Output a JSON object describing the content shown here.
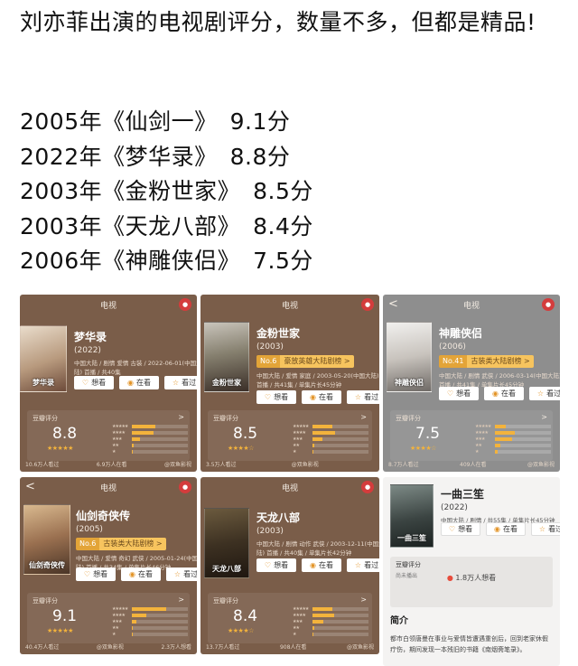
{
  "post": {
    "title": "刘亦菲出演的电视剧评分，数量不多，但都是精品!",
    "ratings": [
      {
        "year": "2005年",
        "title": "《仙剑一》",
        "score": "9.1分"
      },
      {
        "year": "2022年",
        "title": "《梦华录》",
        "score": "8.8分"
      },
      {
        "year": "2003年",
        "title": "《金粉世家》",
        "score": "8.5分"
      },
      {
        "year": "2003年",
        "title": "《天龙八部》",
        "score": "8.4分"
      },
      {
        "year": "2006年",
        "title": "《神雕侠侣》",
        "score": "7.5分"
      }
    ]
  },
  "common": {
    "nav_title": "电视",
    "back": "<",
    "want": "想看",
    "watching": "在看",
    "watched": "看过",
    "score_label": "豆瓣评分",
    "arrow": ">"
  },
  "cards": {
    "menghua": {
      "name": "梦华录",
      "year": "(2022)",
      "meta1": "中国大陆 / 剧情 爱情 古装 / 2022-06-01(中国大",
      "meta2": "陆) 首播 / 共40集",
      "score": "8.8",
      "dist": [
        0.42,
        0.38,
        0.14,
        0.04,
        0.02
      ],
      "footer_left": "10.6万人看过",
      "footer_mid": "6.9万人在看",
      "footer_right": "@双鱼影视",
      "poster_title": "梦华录"
    },
    "jinfen": {
      "name": "金粉世家",
      "year": "(2003)",
      "rank_no": "No.6",
      "rank_label": "豪放英雄大陆剧榜 >",
      "meta1": "中国大陆 / 爱情 家庭 / 2003-05-20(中国大陆)",
      "meta2": "首播 / 共41集 / 单集片长45分钟",
      "score": "8.5",
      "dist": [
        0.36,
        0.4,
        0.18,
        0.04,
        0.02
      ],
      "footer_left": "3.5万人看过",
      "footer_mid": "@双鱼影视",
      "footer_right": "",
      "poster_title": "金粉世家"
    },
    "shendiao": {
      "name": "神雕侠侣",
      "year": "(2006)",
      "rank_no": "No.41",
      "rank_label": "古装类大陆剧榜 >",
      "meta1": "中国大陆 / 剧情 武侠 / 2006-03-14(中国大陆)",
      "meta2": "首播 / 共41集 / 单集片长45分钟",
      "score": "7.5",
      "dist": [
        0.2,
        0.35,
        0.3,
        0.1,
        0.05
      ],
      "footer_left": "8.7万人看过",
      "footer_mid": "409人在看",
      "footer_right": "@双鱼影视",
      "poster_title": "神雕侠侣"
    },
    "xianjian": {
      "name": "仙剑奇侠传",
      "year": "(2005)",
      "rank_no": "No.6",
      "rank_label": "古装类大陆剧榜 >",
      "meta1": "中国大陆 / 爱情 奇幻 武侠 / 2005-01-24(中国大",
      "meta2": "陆) 首播 / 共34集 / 单集片长46分钟",
      "score": "9.1",
      "dist": [
        0.62,
        0.26,
        0.08,
        0.02,
        0.02
      ],
      "footer_left": "40.4万人看过",
      "footer_mid": "@双鱼影视",
      "footer_right": "2.3万人想看",
      "poster_title": "仙剑奇侠传"
    },
    "tianlong": {
      "name": "天龙八部",
      "year": "(2003)",
      "meta1": "中国大陆 / 剧情 动作 武侠 / 2003-12-11(中国大",
      "meta2": "陆) 首播 / 共40集 / 单集片长42分钟",
      "score": "8.4",
      "dist": [
        0.36,
        0.38,
        0.2,
        0.04,
        0.02
      ],
      "footer_left": "13.7万人看过",
      "footer_mid": "908人在看",
      "footer_right": "@双鱼影视",
      "poster_title": "天龙八部"
    },
    "yiqu": {
      "name": "一曲三笙",
      "year": "(2022)",
      "meta1": "中国大陆 / 剧情 / 共55集 / 单集片长45分钟",
      "want_label": "豆瓣评分",
      "want_sub": "尚未播出",
      "want_count": "1.8万人想看",
      "intro_h": "简介",
      "intro_text": "都市白领唐曼在事业与爱情皆遭遇重创后，回到老家休假疗伤，期间发现一本残旧的书籍《南烟斋笔录》。",
      "poster_title": "一曲三笙"
    }
  },
  "colors": {
    "card_brown": "#7a5d49",
    "card_grey": "#8e8e8e",
    "star": "#f3b33c",
    "rank": "#e3a438"
  }
}
